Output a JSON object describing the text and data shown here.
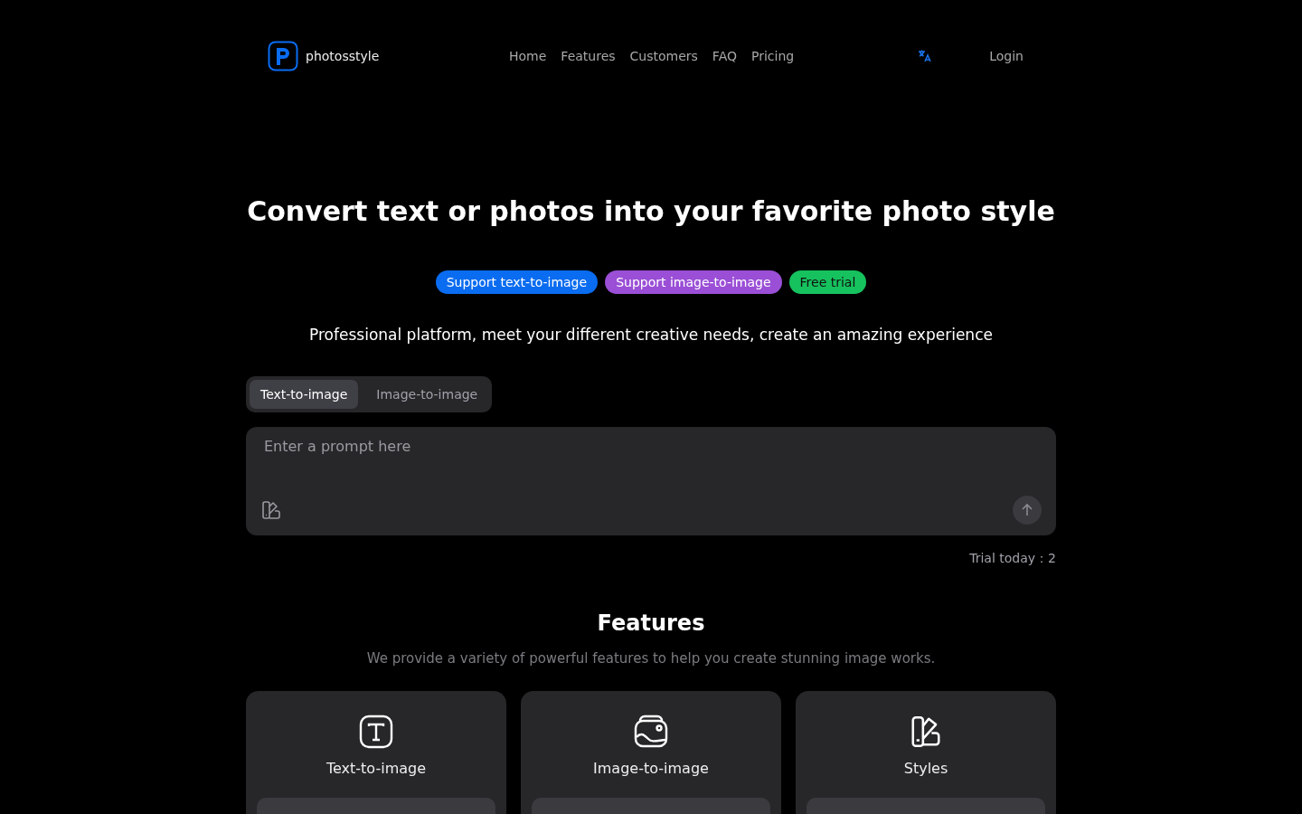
{
  "brand": {
    "name": "photosstyle"
  },
  "nav": [
    {
      "label": "Home"
    },
    {
      "label": "Features"
    },
    {
      "label": "Customers"
    },
    {
      "label": "FAQ"
    },
    {
      "label": "Pricing"
    }
  ],
  "login": "Login",
  "hero": {
    "title": "Convert text or photos into your favorite photo style",
    "badges": [
      {
        "label": "Support text-to-image",
        "color": "#0a6cf0"
      },
      {
        "label": "Support image-to-image",
        "color": "#9a4fd6"
      },
      {
        "label": "Free trial",
        "color": "#16c25e"
      }
    ],
    "subtitle": "Professional platform, meet your different creative needs, create an amazing experience"
  },
  "tabs": [
    {
      "label": "Text-to-image",
      "selected": true
    },
    {
      "label": "Image-to-image",
      "selected": false
    }
  ],
  "prompt": {
    "placeholder": "Enter a prompt here"
  },
  "trial": "Trial today：2",
  "features": {
    "title": "Features",
    "subtitle": "We provide a variety of powerful features to help you create stunning image works.",
    "cards": [
      {
        "kind": "text",
        "title": "Text-to-image"
      },
      {
        "kind": "image",
        "title": "Image-to-image"
      },
      {
        "kind": "styles",
        "title": "Styles"
      }
    ]
  }
}
